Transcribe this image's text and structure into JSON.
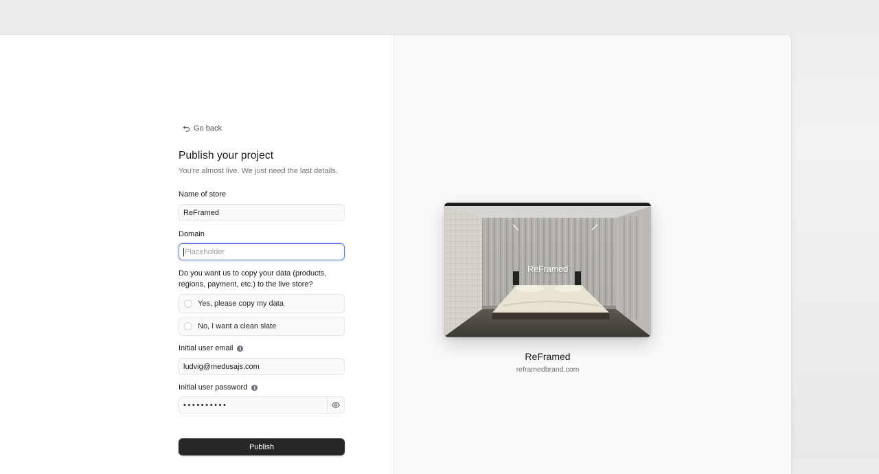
{
  "form": {
    "back_label": "Go back",
    "title": "Publish your project",
    "subtitle": "You're almost live. We just need the last details.",
    "store_name_label": "Name of store",
    "store_name_value": "ReFramed",
    "domain_label": "Domain",
    "domain_placeholder": "Placeholder",
    "copy_question": "Do you want us to copy your data (products, regions, payment, etc.) to the live store?",
    "copy_options": [
      "Yes, please copy my data",
      "No, I want a clean slate"
    ],
    "email_label": "Initial user email",
    "email_value": "ludvig@medusajs.com",
    "password_label": "Initial user password",
    "password_value": "••••••••••",
    "publish_label": "Publish"
  },
  "preview": {
    "logo_text": "ReFramed",
    "store_name": "ReFramed",
    "store_domain": "reframedbrand.com"
  },
  "colors": {
    "focus_ring": "#5c7fe0",
    "button_bg": "#27272a"
  }
}
